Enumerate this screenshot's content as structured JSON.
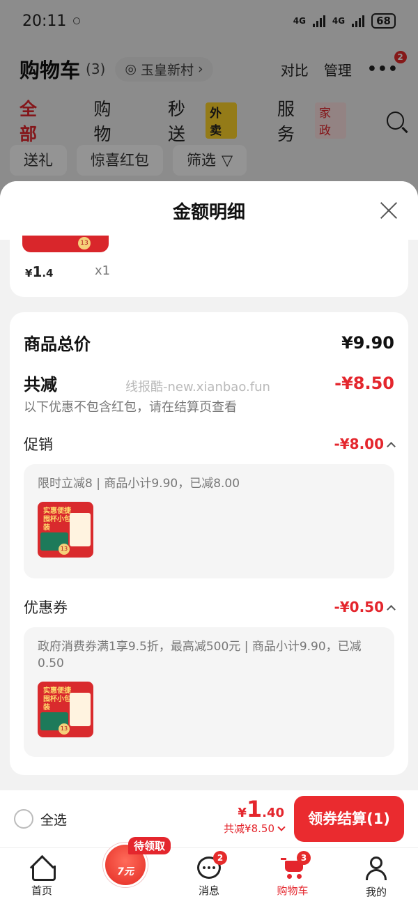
{
  "status_bar": {
    "time": "20:11",
    "network_1": "4G",
    "network_2": "4G",
    "battery": "68"
  },
  "header": {
    "title": "购物车",
    "count": "(3)",
    "location": "玉皇新村",
    "compare": "对比",
    "manage": "管理",
    "more_badge": "2"
  },
  "tabs": [
    {
      "label": "全部",
      "active": true
    },
    {
      "label": "购物"
    },
    {
      "label": "秒送",
      "tag": "外卖"
    },
    {
      "label": "服务",
      "tag": "家政"
    }
  ],
  "chips": [
    "送礼",
    "惊喜红包",
    "筛选"
  ],
  "sheet": {
    "title": "金额明细",
    "item": {
      "price_symbol": "¥",
      "price_int": "1",
      "price_dec": ".4",
      "qty": "x1",
      "badge": "13"
    },
    "total_label": "商品总价",
    "total_value": "¥9.90",
    "reduce_label": "共减",
    "reduce_value": "-¥8.50",
    "watermark": "线报酷-new.xianbao.fun",
    "note": "以下优惠不包含红包，请在结算页查看",
    "promo": {
      "label": "促销",
      "value": "-¥8.00",
      "detail": "限时立减8 | 商品小计9.90，已减8.00"
    },
    "coupon": {
      "label": "优惠券",
      "value": "-¥0.50",
      "detail": "政府消费券满1享9.5折，最高减500元 | 商品小计9.90，已减0.50"
    },
    "thumb": {
      "title": "实惠便捷 囤杯小包装",
      "badge": "13"
    }
  },
  "checkout": {
    "select_all": "全选",
    "currency": "¥",
    "total_int": "1",
    "total_dec": ".40",
    "discount": "共减¥8.50",
    "button": "领券结算(1)"
  },
  "bottom_nav": {
    "home": "首页",
    "promo_tag": "待领取",
    "promo_amount": "7元",
    "messages": "消息",
    "messages_badge": "2",
    "cart": "购物车",
    "cart_badge": "3",
    "me": "我的"
  },
  "colors": {
    "accent": "#e4262d",
    "tag_yellow": "#ffd42a",
    "overlay": "rgba(0,0,0,0.42)"
  }
}
